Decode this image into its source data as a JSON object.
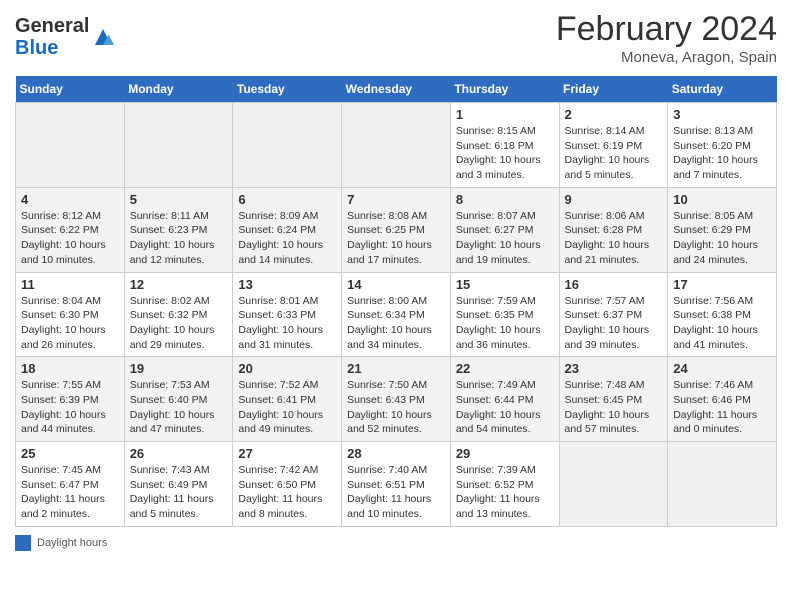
{
  "header": {
    "logo_general": "General",
    "logo_blue": "Blue",
    "title": "February 2024",
    "subtitle": "Moneva, Aragon, Spain"
  },
  "weekdays": [
    "Sunday",
    "Monday",
    "Tuesday",
    "Wednesday",
    "Thursday",
    "Friday",
    "Saturday"
  ],
  "weeks": [
    [
      {
        "day": "",
        "info": ""
      },
      {
        "day": "",
        "info": ""
      },
      {
        "day": "",
        "info": ""
      },
      {
        "day": "",
        "info": ""
      },
      {
        "day": "1",
        "info": "Sunrise: 8:15 AM\nSunset: 6:18 PM\nDaylight: 10 hours\nand 3 minutes."
      },
      {
        "day": "2",
        "info": "Sunrise: 8:14 AM\nSunset: 6:19 PM\nDaylight: 10 hours\nand 5 minutes."
      },
      {
        "day": "3",
        "info": "Sunrise: 8:13 AM\nSunset: 6:20 PM\nDaylight: 10 hours\nand 7 minutes."
      }
    ],
    [
      {
        "day": "4",
        "info": "Sunrise: 8:12 AM\nSunset: 6:22 PM\nDaylight: 10 hours\nand 10 minutes."
      },
      {
        "day": "5",
        "info": "Sunrise: 8:11 AM\nSunset: 6:23 PM\nDaylight: 10 hours\nand 12 minutes."
      },
      {
        "day": "6",
        "info": "Sunrise: 8:09 AM\nSunset: 6:24 PM\nDaylight: 10 hours\nand 14 minutes."
      },
      {
        "day": "7",
        "info": "Sunrise: 8:08 AM\nSunset: 6:25 PM\nDaylight: 10 hours\nand 17 minutes."
      },
      {
        "day": "8",
        "info": "Sunrise: 8:07 AM\nSunset: 6:27 PM\nDaylight: 10 hours\nand 19 minutes."
      },
      {
        "day": "9",
        "info": "Sunrise: 8:06 AM\nSunset: 6:28 PM\nDaylight: 10 hours\nand 21 minutes."
      },
      {
        "day": "10",
        "info": "Sunrise: 8:05 AM\nSunset: 6:29 PM\nDaylight: 10 hours\nand 24 minutes."
      }
    ],
    [
      {
        "day": "11",
        "info": "Sunrise: 8:04 AM\nSunset: 6:30 PM\nDaylight: 10 hours\nand 26 minutes."
      },
      {
        "day": "12",
        "info": "Sunrise: 8:02 AM\nSunset: 6:32 PM\nDaylight: 10 hours\nand 29 minutes."
      },
      {
        "day": "13",
        "info": "Sunrise: 8:01 AM\nSunset: 6:33 PM\nDaylight: 10 hours\nand 31 minutes."
      },
      {
        "day": "14",
        "info": "Sunrise: 8:00 AM\nSunset: 6:34 PM\nDaylight: 10 hours\nand 34 minutes."
      },
      {
        "day": "15",
        "info": "Sunrise: 7:59 AM\nSunset: 6:35 PM\nDaylight: 10 hours\nand 36 minutes."
      },
      {
        "day": "16",
        "info": "Sunrise: 7:57 AM\nSunset: 6:37 PM\nDaylight: 10 hours\nand 39 minutes."
      },
      {
        "day": "17",
        "info": "Sunrise: 7:56 AM\nSunset: 6:38 PM\nDaylight: 10 hours\nand 41 minutes."
      }
    ],
    [
      {
        "day": "18",
        "info": "Sunrise: 7:55 AM\nSunset: 6:39 PM\nDaylight: 10 hours\nand 44 minutes."
      },
      {
        "day": "19",
        "info": "Sunrise: 7:53 AM\nSunset: 6:40 PM\nDaylight: 10 hours\nand 47 minutes."
      },
      {
        "day": "20",
        "info": "Sunrise: 7:52 AM\nSunset: 6:41 PM\nDaylight: 10 hours\nand 49 minutes."
      },
      {
        "day": "21",
        "info": "Sunrise: 7:50 AM\nSunset: 6:43 PM\nDaylight: 10 hours\nand 52 minutes."
      },
      {
        "day": "22",
        "info": "Sunrise: 7:49 AM\nSunset: 6:44 PM\nDaylight: 10 hours\nand 54 minutes."
      },
      {
        "day": "23",
        "info": "Sunrise: 7:48 AM\nSunset: 6:45 PM\nDaylight: 10 hours\nand 57 minutes."
      },
      {
        "day": "24",
        "info": "Sunrise: 7:46 AM\nSunset: 6:46 PM\nDaylight: 11 hours\nand 0 minutes."
      }
    ],
    [
      {
        "day": "25",
        "info": "Sunrise: 7:45 AM\nSunset: 6:47 PM\nDaylight: 11 hours\nand 2 minutes."
      },
      {
        "day": "26",
        "info": "Sunrise: 7:43 AM\nSunset: 6:49 PM\nDaylight: 11 hours\nand 5 minutes."
      },
      {
        "day": "27",
        "info": "Sunrise: 7:42 AM\nSunset: 6:50 PM\nDaylight: 11 hours\nand 8 minutes."
      },
      {
        "day": "28",
        "info": "Sunrise: 7:40 AM\nSunset: 6:51 PM\nDaylight: 11 hours\nand 10 minutes."
      },
      {
        "day": "29",
        "info": "Sunrise: 7:39 AM\nSunset: 6:52 PM\nDaylight: 11 hours\nand 13 minutes."
      },
      {
        "day": "",
        "info": ""
      },
      {
        "day": "",
        "info": ""
      }
    ]
  ],
  "legend": {
    "daylight_label": "Daylight hours"
  }
}
